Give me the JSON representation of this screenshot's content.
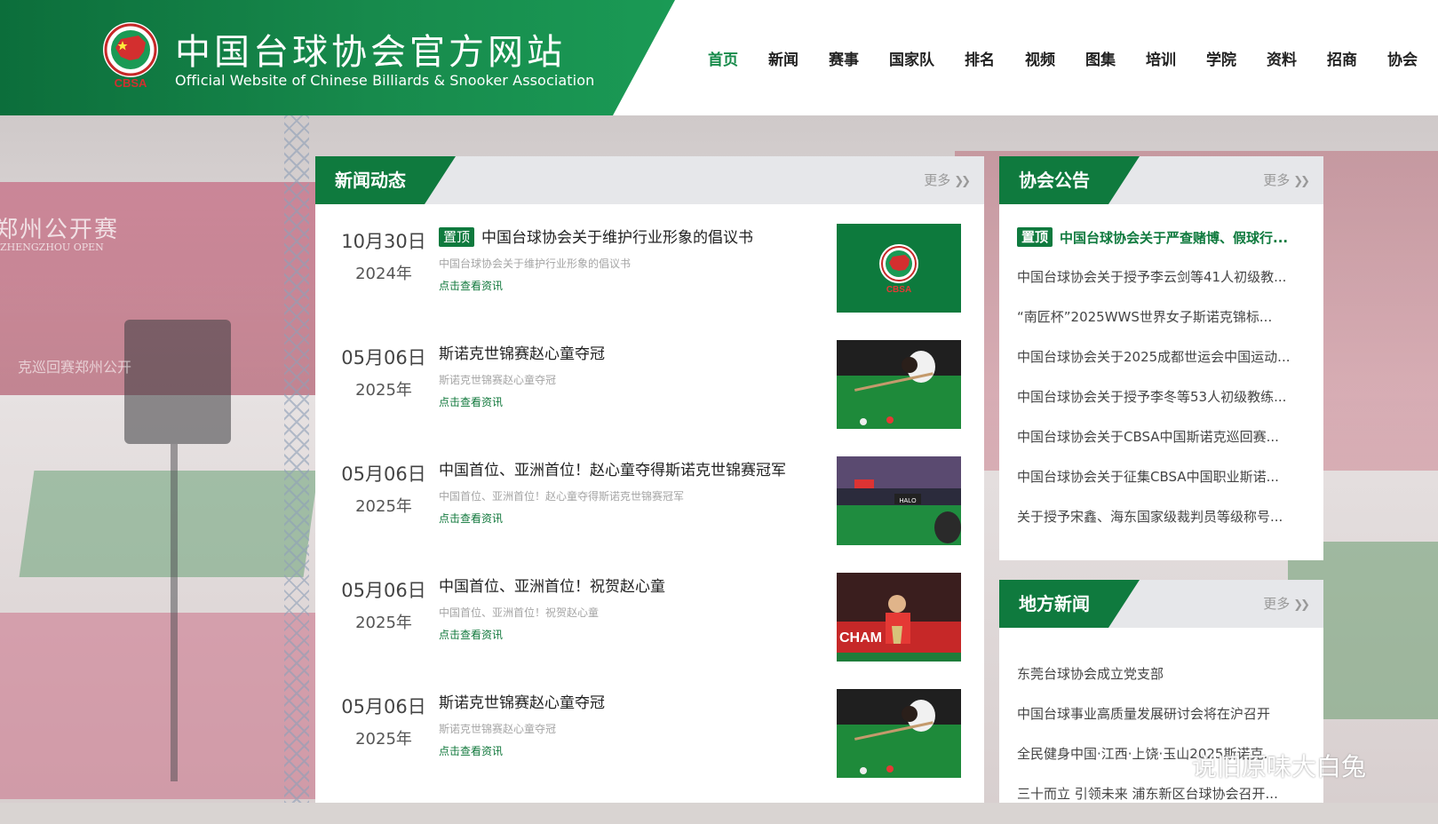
{
  "header": {
    "title": "中国台球协会官方网站",
    "subtitle": "Official Website of Chinese Billiards & Snooker Association",
    "logo_text": "CBSA",
    "colors": {
      "brand_green": "#0f7a3e",
      "accent_green": "#168a4a"
    }
  },
  "nav": {
    "items": [
      {
        "label": "首页",
        "active": true
      },
      {
        "label": "新闻"
      },
      {
        "label": "赛事"
      },
      {
        "label": "国家队"
      },
      {
        "label": "排名"
      },
      {
        "label": "视频"
      },
      {
        "label": "图集"
      },
      {
        "label": "培训"
      },
      {
        "label": "学院"
      },
      {
        "label": "资料"
      },
      {
        "label": "招商"
      },
      {
        "label": "协会"
      }
    ]
  },
  "background": {
    "sign_title": "郑州公开赛",
    "sign_en": "ZHENGZHOU OPEN",
    "sign_bottom": "克巡回赛郑州公开"
  },
  "news": {
    "title": "新闻动态",
    "more": "更多",
    "items": [
      {
        "date": "10月30日",
        "year": "2024年",
        "badge": "置顶",
        "title": "中国台球协会关于维护行业形象的倡议书",
        "summary": "中国台球协会关于维护行业形象的倡议书",
        "link": "点击查看资讯",
        "thumb": "logo"
      },
      {
        "date": "05月06日",
        "year": "2025年",
        "title": "斯诺克世锦赛赵心童夺冠",
        "summary": "斯诺克世锦赛赵心童夺冠",
        "link": "点击查看资讯",
        "thumb": "player"
      },
      {
        "date": "05月06日",
        "year": "2025年",
        "title": "中国首位、亚洲首位！赵心童夺得斯诺克世锦赛冠军",
        "summary": "中国首位、亚洲首位！赵心童夺得斯诺克世锦赛冠军",
        "link": "点击查看资讯",
        "thumb": "arena",
        "thumb_text": "HALO"
      },
      {
        "date": "05月06日",
        "year": "2025年",
        "title": "中国首位、亚洲首位！祝贺赵心童",
        "summary": "中国首位、亚洲首位！祝贺赵心童",
        "link": "点击查看资讯",
        "thumb": "trophy",
        "thumb_text": "CHAM"
      },
      {
        "date": "05月06日",
        "year": "2025年",
        "title": "斯诺克世锦赛赵心童夺冠",
        "summary": "斯诺克世锦赛赵心童夺冠",
        "link": "点击查看资讯",
        "thumb": "player"
      }
    ]
  },
  "notices": {
    "title": "协会公告",
    "more": "更多",
    "badge": "置顶",
    "items": [
      "中国台球协会关于严查赌博、假球行...",
      "中国台球协会关于授予李云剑等41人初级教...",
      "“南匠杯”2025WWS世界女子斯诺克锦标...",
      "中国台球协会关于2025成都世运会中国运动...",
      "中国台球协会关于授予李冬等53人初级教练...",
      "中国台球协会关于CBSA中国斯诺克巡回赛...",
      "中国台球协会关于征集CBSA中国职业斯诺...",
      "关于授予宋鑫、海东国家级裁判员等级称号..."
    ]
  },
  "local": {
    "title": "地方新闻",
    "more": "更多",
    "items": [
      "东莞台球协会成立党支部",
      "中国台球事业高质量发展研讨会将在沪召开",
      "全民健身中国·江西·上饶·玉山2025斯诺克...",
      "三十而立 引领未来 浦东新区台球协会召开..."
    ]
  },
  "watermark": "说旧原味大白兔"
}
